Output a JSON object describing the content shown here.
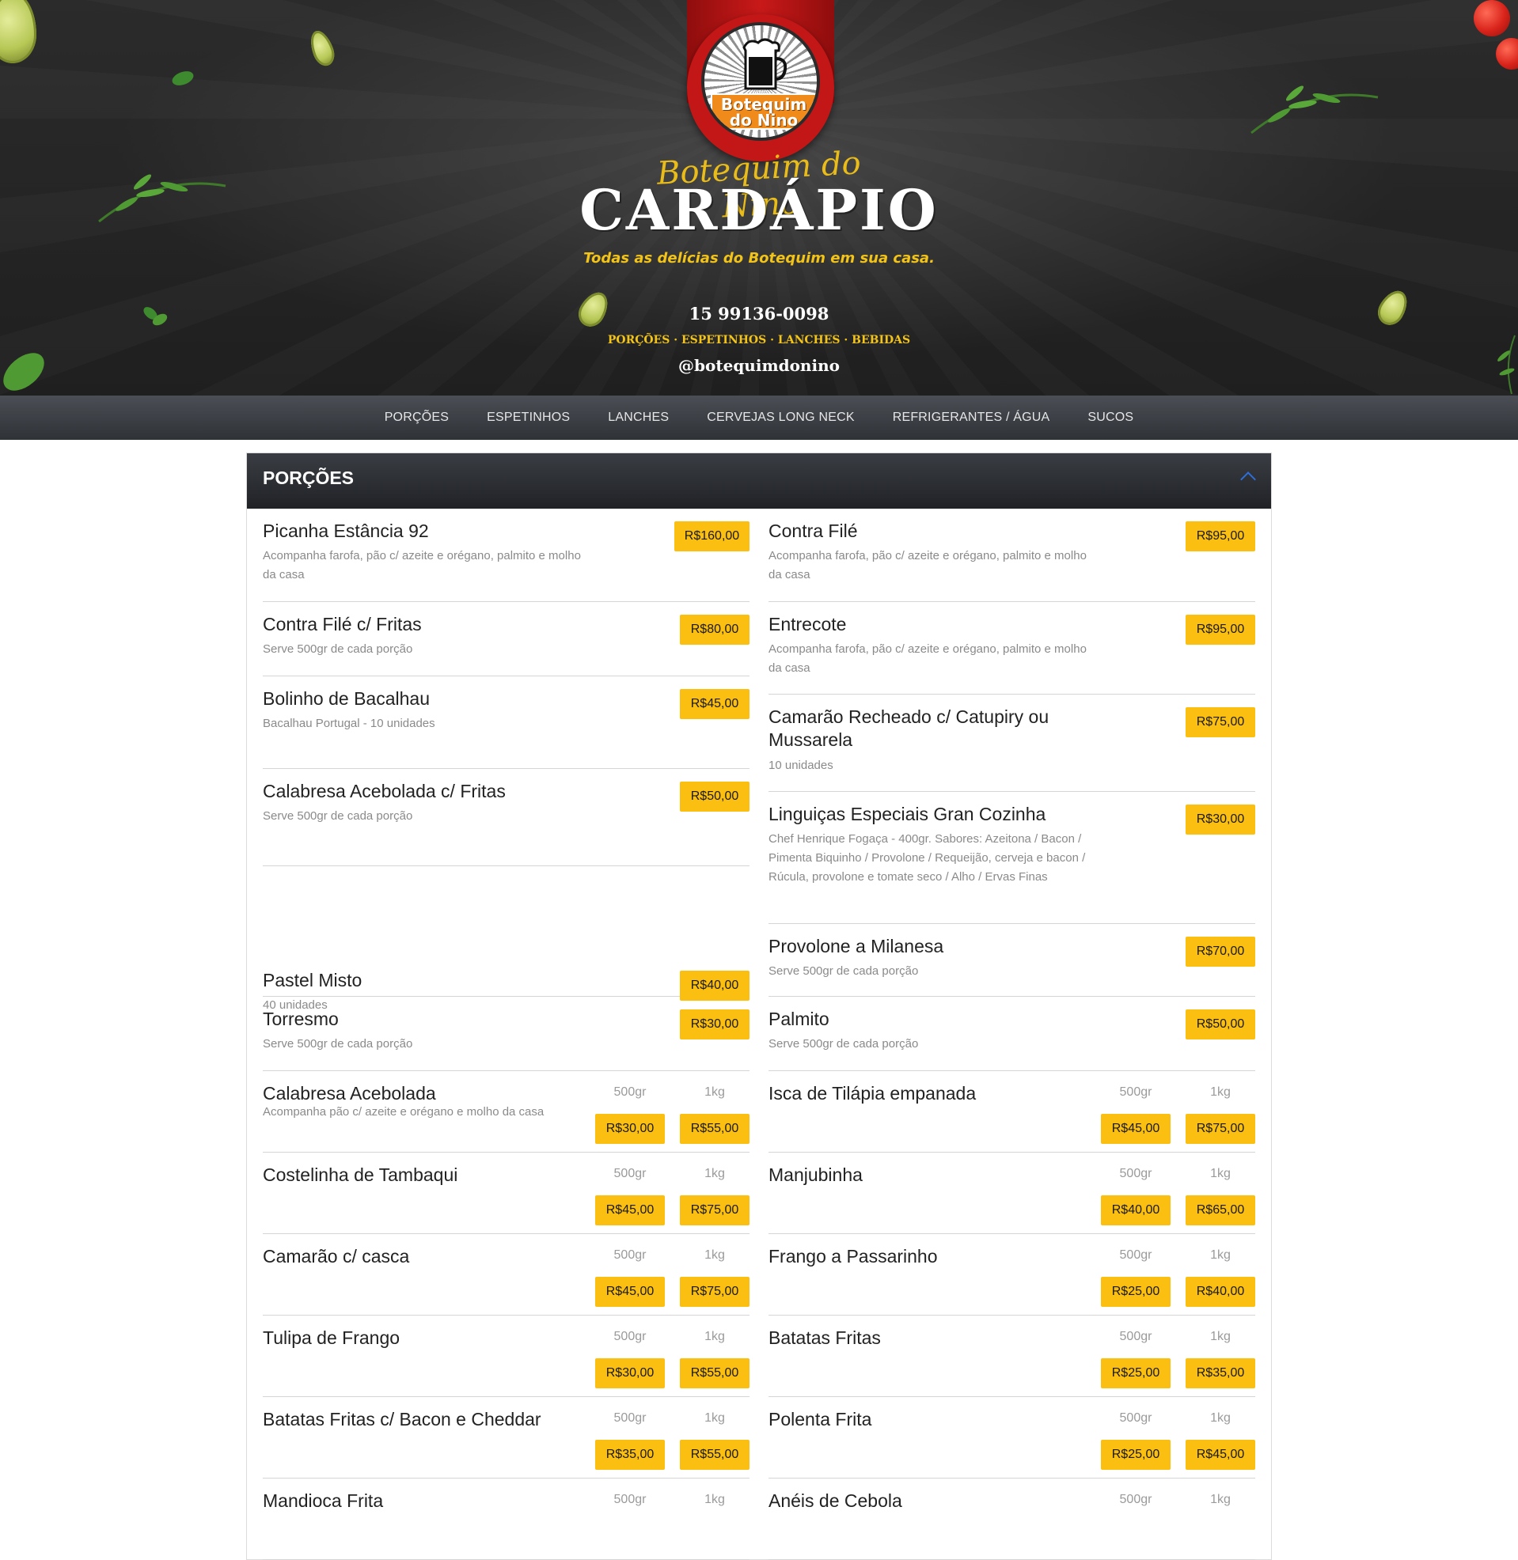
{
  "hero": {
    "logo_text": "Botequim do Nino",
    "script_text": "Botequim do Nino",
    "title": "CARDÁPIO",
    "subtitle": "Todas as delícias do Botequim em sua casa.",
    "phone": "15 99136-0098",
    "categories": "PORÇÕES · ESPETINHOS · LANCHES · BEBIDAS",
    "instagram": "@botequimdonino"
  },
  "nav": [
    "PORÇÕES",
    "ESPETINHOS",
    "LANCHES",
    "CERVEJAS LONG NECK",
    "REFRIGERANTES / ÁGUA",
    "SUCOS"
  ],
  "section": {
    "title": "PORÇÕES"
  },
  "left": [
    {
      "name": "Picanha Estância 92",
      "desc": "Acompanha farofa, pão c/ azeite e orégano, palmito e molho da casa",
      "price": "R$160,00"
    },
    {
      "name": "Contra Filé c/ Fritas",
      "desc": "Serve 500gr de cada porção",
      "price": "R$80,00"
    },
    {
      "name": "Bolinho de Bacalhau",
      "desc": "Bacalhau Portugal - 10 unidades",
      "price": "R$45,00"
    },
    {
      "name": "Calabresa Acebolada c/ Fritas",
      "desc": "Serve 500gr de cada porção",
      "price": "R$50,00"
    },
    {
      "name": "Pastel Misto",
      "desc": "40 unidades",
      "price": "R$40,00"
    },
    {
      "name": "Torresmo",
      "desc": "Serve 500gr de cada porção",
      "price": "R$30,00"
    },
    {
      "name": "Calabresa Acebolada",
      "desc": "Acompanha pão c/ azeite e orégano e molho da casa",
      "size1": "500gr",
      "size2": "1kg",
      "price1": "R$30,00",
      "price2": "R$55,00"
    },
    {
      "name": "Costelinha de Tambaqui",
      "desc": "",
      "size1": "500gr",
      "size2": "1kg",
      "price1": "R$45,00",
      "price2": "R$75,00"
    },
    {
      "name": "Camarão c/ casca",
      "desc": "",
      "size1": "500gr",
      "size2": "1kg",
      "price1": "R$45,00",
      "price2": "R$75,00"
    },
    {
      "name": "Tulipa de Frango",
      "desc": "",
      "size1": "500gr",
      "size2": "1kg",
      "price1": "R$30,00",
      "price2": "R$55,00"
    },
    {
      "name": "Batatas Fritas c/ Bacon e Cheddar",
      "desc": "",
      "size1": "500gr",
      "size2": "1kg",
      "price1": "R$35,00",
      "price2": "R$55,00"
    },
    {
      "name": "Mandioca Frita",
      "desc": "",
      "size1": "500gr",
      "size2": "1kg",
      "price1": "",
      "price2": ""
    }
  ],
  "right": [
    {
      "name": "Contra Filé",
      "desc": "Acompanha farofa, pão c/ azeite e orégano, palmito e molho da casa",
      "price": "R$95,00"
    },
    {
      "name": "Entrecote",
      "desc": "Acompanha farofa, pão c/ azeite e orégano, palmito e molho da casa",
      "price": "R$95,00"
    },
    {
      "name": "Camarão Recheado c/ Catupiry ou Mussarela",
      "desc": "10 unidades",
      "price": "R$75,00"
    },
    {
      "name": "Linguiças Especiais Gran Cozinha",
      "desc": "Chef Henrique Fogaça - 400gr. Sabores: Azeitona / Bacon / Pimenta Biquinho / Provolone / Requeijão, cerveja e bacon / Rúcula, provolone e tomate seco / Alho / Ervas Finas",
      "price": "R$30,00"
    },
    {
      "name": "Provolone a Milanesa",
      "desc": "Serve 500gr de cada porção",
      "price": "R$70,00"
    },
    {
      "name": "Palmito",
      "desc": "Serve 500gr de cada porção",
      "price": "R$50,00"
    },
    {
      "name": "Isca de Tilápia empanada",
      "desc": "",
      "size1": "500gr",
      "size2": "1kg",
      "price1": "R$45,00",
      "price2": "R$75,00"
    },
    {
      "name": "Manjubinha",
      "desc": "",
      "size1": "500gr",
      "size2": "1kg",
      "price1": "R$40,00",
      "price2": "R$65,00"
    },
    {
      "name": "Frango a Passarinho",
      "desc": "",
      "size1": "500gr",
      "size2": "1kg",
      "price1": "R$25,00",
      "price2": "R$40,00"
    },
    {
      "name": "Batatas Fritas",
      "desc": "",
      "size1": "500gr",
      "size2": "1kg",
      "price1": "R$25,00",
      "price2": "R$35,00"
    },
    {
      "name": "Polenta Frita",
      "desc": "",
      "size1": "500gr",
      "size2": "1kg",
      "price1": "R$25,00",
      "price2": "R$45,00"
    },
    {
      "name": "Anéis de Cebola",
      "desc": "",
      "size1": "500gr",
      "size2": "1kg",
      "price1": "",
      "price2": ""
    }
  ],
  "colors": {
    "price_bg": "#fbbf11",
    "accent_text": "#f2c318",
    "nav_bg": "#3a3d43"
  }
}
